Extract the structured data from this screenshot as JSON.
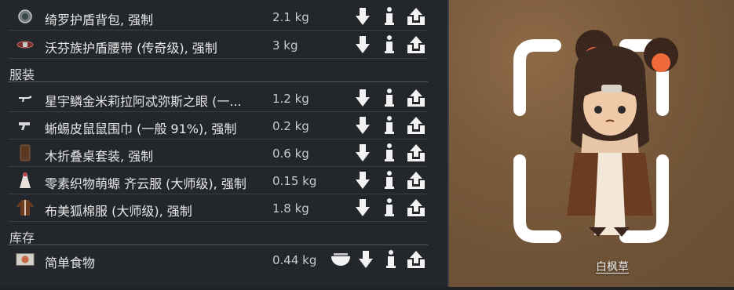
{
  "inventory": {
    "top_items": [
      {
        "icon": "shield-pack-icon",
        "name": "绮罗护盾背包, 强制",
        "weight": "2.1 kg"
      },
      {
        "icon": "shield-belt-icon",
        "name": "沃芬族护盾腰带 (传奇级), 强制",
        "weight": "3 kg"
      }
    ],
    "sections": {
      "apparel": "服装",
      "stock": "库存"
    },
    "apparel_items": [
      {
        "icon": "gun-icon",
        "name": "星宇鳞金米莉拉阿忒弥斯之眼 (一...",
        "weight": "1.2 kg"
      },
      {
        "icon": "pistol-icon",
        "name": "蜥蜴皮鼠鼠围巾 (一般 91%), 强制",
        "weight": "0.2 kg"
      },
      {
        "icon": "table-set-icon",
        "name": "木折叠桌套装, 强制",
        "weight": "0.6 kg"
      },
      {
        "icon": "dress-icon",
        "name": "零素织物萌螈 齐云服 (大师级), 强制",
        "weight": "0.15 kg"
      },
      {
        "icon": "coat-icon",
        "name": "布美狐棉服 (大师级), 强制",
        "weight": "1.8 kg"
      }
    ],
    "stock_items": [
      {
        "icon": "meal-icon",
        "name": "简单食物",
        "weight": "0.44 kg"
      }
    ]
  },
  "character": {
    "name": "白枫草"
  },
  "colors": {
    "panel_bg": "#23272b",
    "divider": "#3a3f45",
    "scene_brown": "#7b5b3d",
    "button_white": "#f2f2f2"
  }
}
